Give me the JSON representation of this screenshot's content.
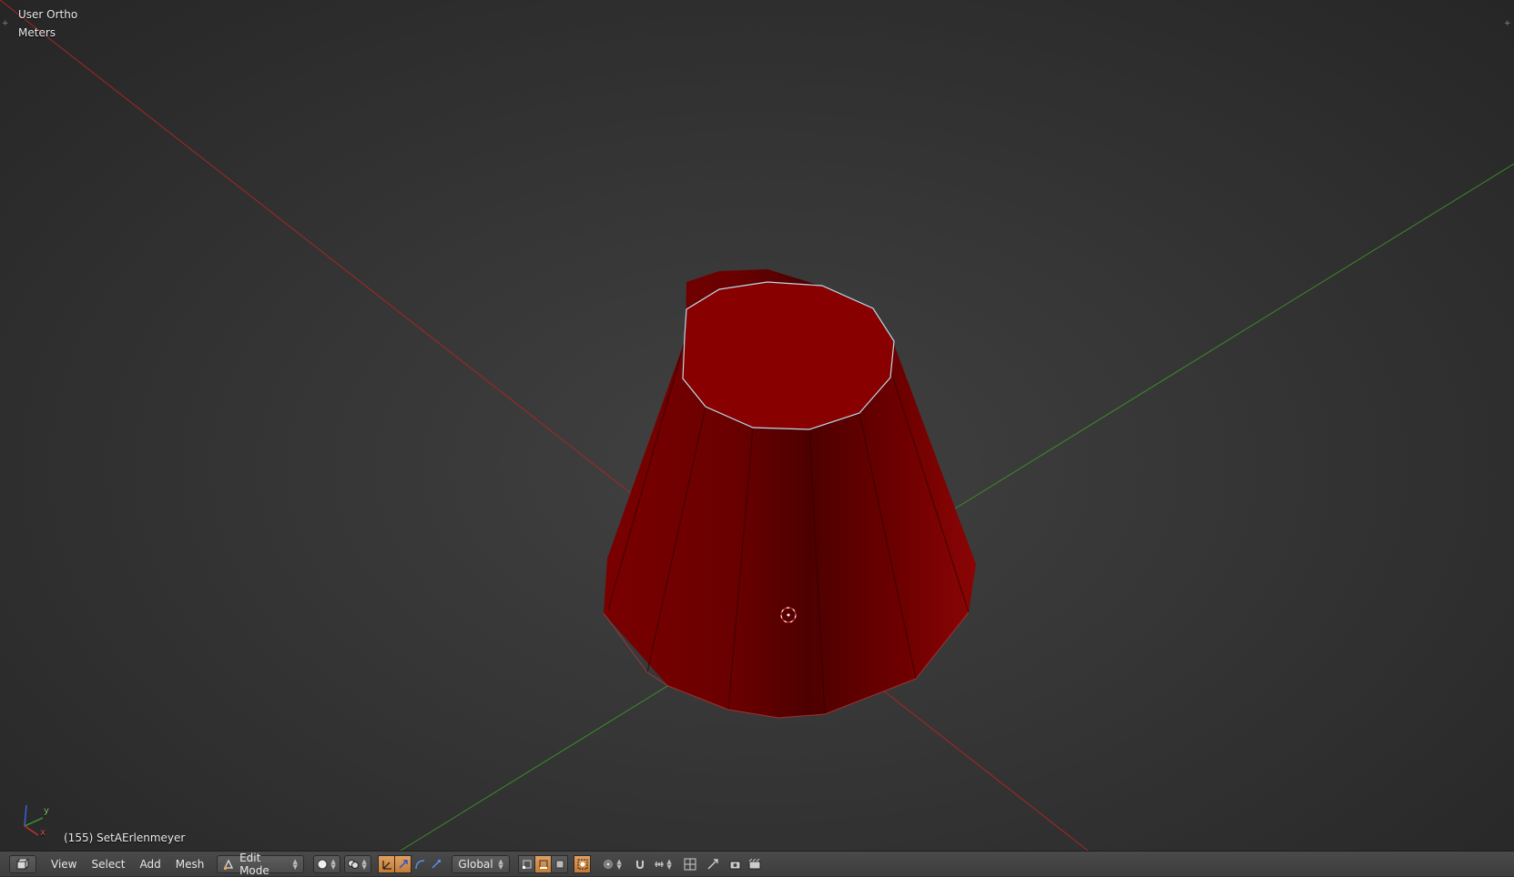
{
  "viewport": {
    "view_label": "User Ortho",
    "units_label": "Meters",
    "object_info": "(155) SetAErlenmeyer",
    "colors": {
      "background": "#353535",
      "x_axis": "#b82a2a",
      "y_axis": "#3b9a2a",
      "mesh_face": "#8a0000",
      "mesh_top": "#8c0000",
      "edge_selected": "#a9d7e8"
    },
    "axis_gizmo": {
      "x_label": "x",
      "y_label": "y",
      "z_label": "z"
    }
  },
  "footer": {
    "editor_icon": "3d-view-icon",
    "menus": [
      "View",
      "Select",
      "Add",
      "Mesh"
    ],
    "mode": "Edit Mode",
    "orientation": "Global",
    "icons": {
      "viewport_shading": "solid-sphere-icon",
      "pivot": "pivot-point-icon",
      "manipulator_translate": "manipulator-translate-icon",
      "manipulator_rotate": "manipulator-rotate-icon",
      "manipulator_scale": "manipulator-scale-icon",
      "select_vertex": "vertex-select-icon",
      "select_edge": "edge-select-icon",
      "select_face": "face-select-icon",
      "occlude": "occlude-geometry-icon",
      "proportional": "proportional-edit-icon",
      "snap": "magnet-icon",
      "snap_element": "snap-increment-icon",
      "snap_target": "snap-target-icon",
      "render": "render-icon",
      "render_anim": "render-animation-icon"
    }
  }
}
